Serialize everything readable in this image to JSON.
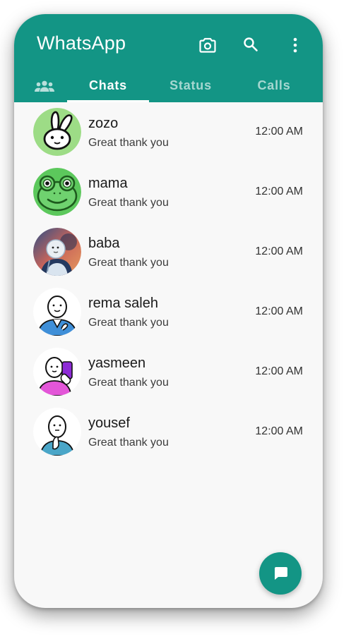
{
  "app": {
    "title": "WhatsApp"
  },
  "colors": {
    "primary": "#139585",
    "background": "#f8f8f8",
    "tab_inactive": "rgba(255,255,255,0.62)"
  },
  "toolbar": {
    "icons": [
      "camera-icon",
      "search-icon",
      "more-vert-icon"
    ]
  },
  "tabs": {
    "community_icon": "community-icon",
    "chats": "Chats",
    "status": "Status",
    "calls": "Calls",
    "active": "Chats"
  },
  "chats": [
    {
      "name": "zozo",
      "message": "Great thank you",
      "time": "12:00 AM",
      "avatar": "rabbit-avatar"
    },
    {
      "name": "mama",
      "message": "Great thank you",
      "time": "12:00 AM",
      "avatar": "frog-avatar"
    },
    {
      "name": "baba",
      "message": "Great thank you",
      "time": "12:00 AM",
      "avatar": "astronaut-avatar"
    },
    {
      "name": "rema saleh",
      "message": "Great thank you",
      "time": "12:00 AM",
      "avatar": "blue-shirt-avatar"
    },
    {
      "name": "yasmeen",
      "message": "Great thank you",
      "time": "12:00 AM",
      "avatar": "pink-selfie-avatar"
    },
    {
      "name": "yousef",
      "message": "Great thank you",
      "time": "12:00 AM",
      "avatar": "thinking-avatar"
    }
  ],
  "fab": {
    "icon": "new-chat-icon"
  }
}
